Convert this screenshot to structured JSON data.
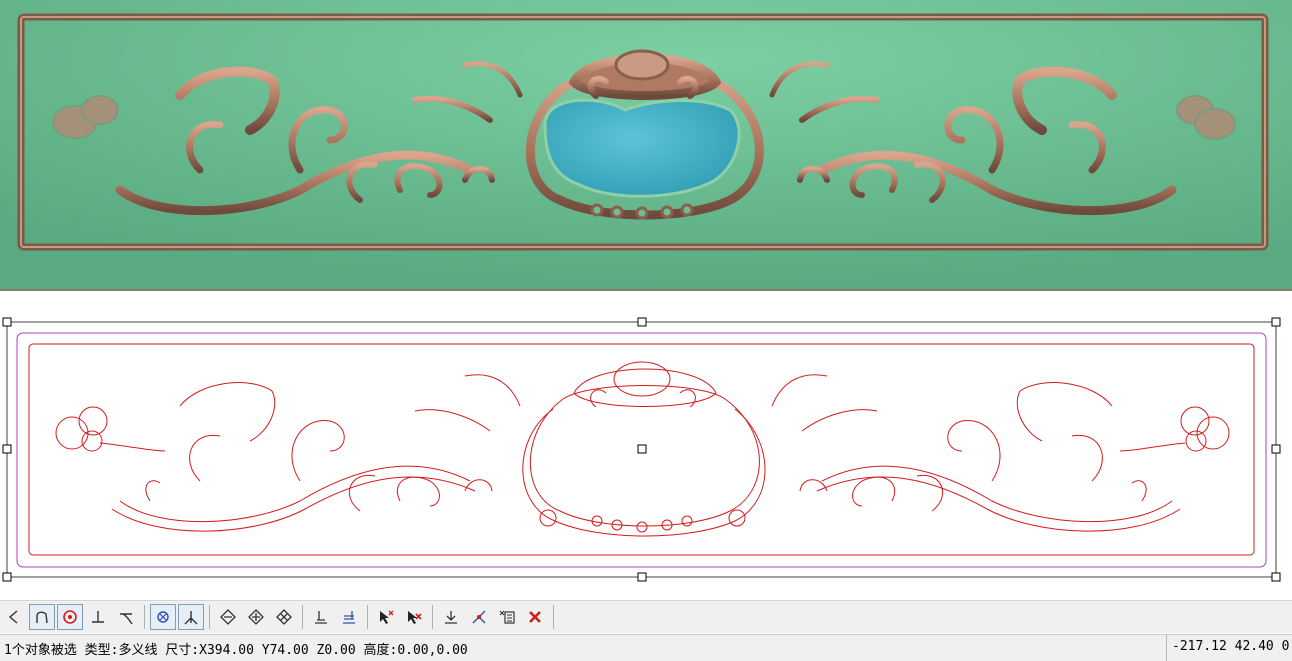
{
  "render_view": {
    "panel_color": "#6bbf92",
    "relief_color": "#b07a62",
    "water_color": "#4bb3c6"
  },
  "vector_view": {
    "outline_color": "#d21c1c",
    "boundary_color": "#b23cc0"
  },
  "toolbar": {
    "tools": [
      {
        "name": "arc-tool-icon"
      },
      {
        "name": "curve-tool-icon"
      },
      {
        "name": "circle-snap-icon",
        "active": true
      },
      {
        "name": "perpendicular-snap-icon"
      },
      {
        "name": "tangent-snap-icon"
      },
      {
        "name": "center-snap-icon",
        "active": true
      },
      {
        "name": "intersection-snap-icon",
        "active": true
      },
      {
        "name": "node-edit-icon"
      },
      {
        "name": "node-add-icon"
      },
      {
        "name": "node-delete-icon"
      },
      {
        "name": "align-left-icon"
      },
      {
        "name": "align-center-icon"
      },
      {
        "name": "select-add-icon"
      },
      {
        "name": "select-remove-icon"
      },
      {
        "name": "join-icon"
      },
      {
        "name": "trim-icon"
      },
      {
        "name": "list-select-icon"
      },
      {
        "name": "delete-icon"
      }
    ]
  },
  "status": {
    "message": "1个对象被选 类型:多义线 尺寸:X394.00 Y74.00 Z0.00 高度:0.00,0.00",
    "coords": "-217.12 42.40 0"
  }
}
